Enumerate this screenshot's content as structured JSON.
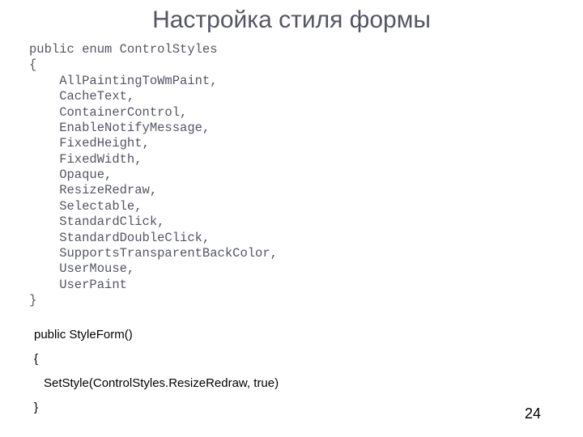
{
  "title": "Настройка стиля формы",
  "enum_code": "public enum ControlStyles\n{\n    AllPaintingToWmPaint,\n    CacheText,\n    ContainerControl,\n    EnableNotifyMessage,\n    FixedHeight,\n    FixedWidth,\n    Opaque,\n    ResizeRedraw,\n    Selectable,\n    StandardClick,\n    StandardDoubleClick,\n    SupportsTransparentBackColor,\n    UserMouse,\n    UserPaint\n}",
  "constructor": {
    "line1": "public StyleForm()",
    "line2": "{",
    "line3": "SetStyle(ControlStyles.ResizeRedraw, true)",
    "line4": "}"
  },
  "page_number": "24"
}
